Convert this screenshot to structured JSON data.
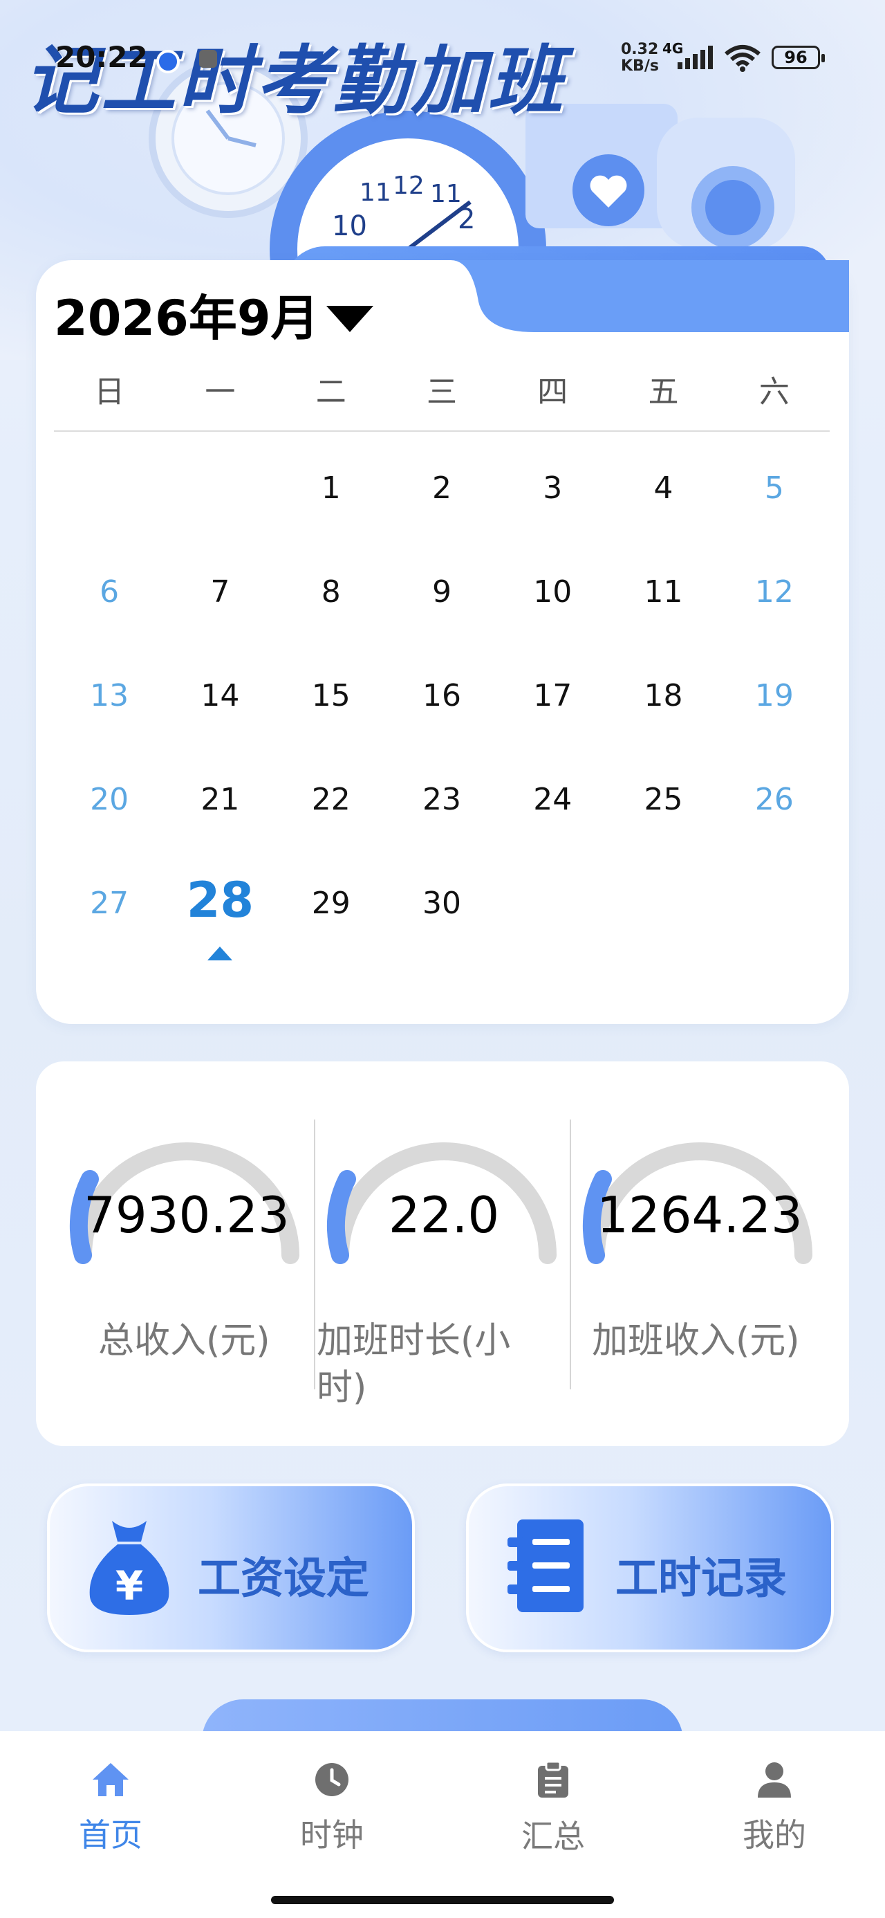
{
  "status_bar": {
    "time": "20:22",
    "net_speed_value": "0.32",
    "net_speed_unit": "KB/s",
    "network": "4G",
    "battery": "96"
  },
  "header": {
    "title": "记工时考勤加班"
  },
  "calendar": {
    "month_label": "2026年9月",
    "weekdays": [
      "日",
      "一",
      "二",
      "三",
      "四",
      "五",
      "六"
    ],
    "weeks": [
      [
        "",
        "",
        "1",
        "2",
        "3",
        "4",
        "5"
      ],
      [
        "6",
        "7",
        "8",
        "9",
        "10",
        "11",
        "12"
      ],
      [
        "13",
        "14",
        "15",
        "16",
        "17",
        "18",
        "19"
      ],
      [
        "20",
        "21",
        "22",
        "23",
        "24",
        "25",
        "26"
      ],
      [
        "27",
        "28",
        "29",
        "30",
        "",
        "",
        ""
      ]
    ],
    "selected_day": "28"
  },
  "stats": [
    {
      "value": "7930.23",
      "label": "总收入(元)",
      "fill_fraction": 0.12
    },
    {
      "value": "22.0",
      "label": "加班时长(小时)",
      "fill_fraction": 0.12
    },
    {
      "value": "1264.23",
      "label": "加班收入(元)",
      "fill_fraction": 0.12
    }
  ],
  "actions": {
    "salary_setting": "工资设定",
    "hours_record": "工时记录"
  },
  "bottom_nav": {
    "items": [
      {
        "label": "首页",
        "icon": "home-icon",
        "active": true
      },
      {
        "label": "时钟",
        "icon": "clock-icon",
        "active": false
      },
      {
        "label": "汇总",
        "icon": "clipboard-icon",
        "active": false
      },
      {
        "label": "我的",
        "icon": "user-icon",
        "active": false
      }
    ]
  },
  "colors": {
    "accent": "#3f86e8",
    "weekend": "#5ba7e2",
    "today": "#2283d9",
    "gauge_track": "#d9d9d9",
    "gauge_fill": "#5f93f2"
  }
}
